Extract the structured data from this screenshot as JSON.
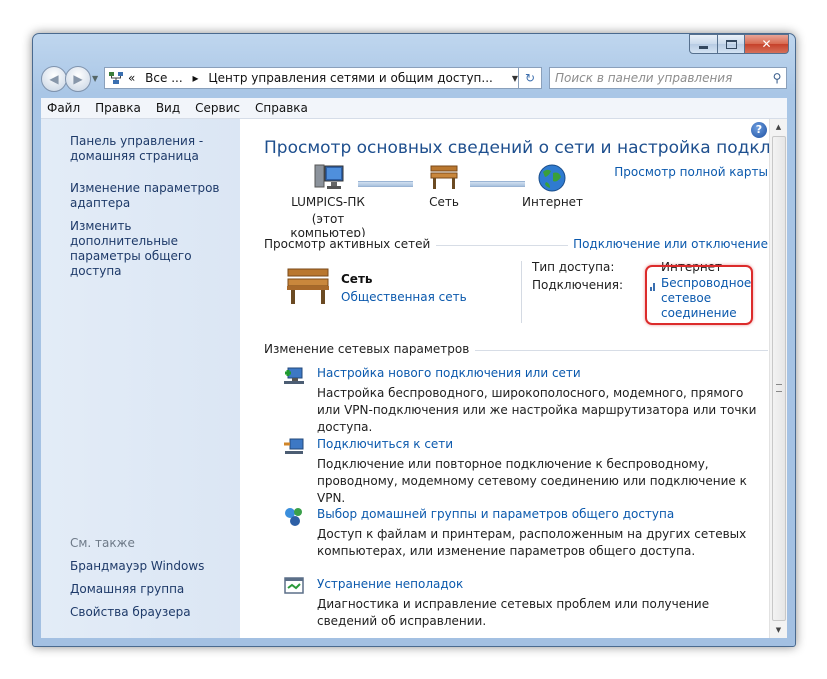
{
  "window": {
    "minimize_label": "minimize",
    "maximize_label": "maximize",
    "close_glyph": "✕"
  },
  "nav": {
    "back_icon": "◀",
    "forward_icon": "▶",
    "address_icon": "network-center-icon",
    "crumbs": [
      "Все ...",
      "Центр управления сетями и общим доступ..."
    ],
    "crumb_prefix": "«",
    "crumb_separator": "▸",
    "refresh_icon": "↻",
    "search_placeholder": "Поиск в панели управления"
  },
  "menu": [
    "Файл",
    "Правка",
    "Вид",
    "Сервис",
    "Справка"
  ],
  "sidebar": {
    "links": [
      "Панель управления - домашняя страница",
      "Изменение параметров адаптера",
      "Изменить дополнительные параметры общего доступа"
    ],
    "see_also_title": "См. также",
    "see_also": [
      "Брандмауэр Windows",
      "Домашняя группа",
      "Свойства браузера"
    ]
  },
  "main": {
    "title": "Просмотр основных сведений о сети и настройка подключений",
    "full_map_link": "Просмотр полной карты",
    "map": {
      "computer": "LUMPICS-ПК",
      "computer_note": "(этот компьютер)",
      "network": "Сеть",
      "internet": "Интернет"
    },
    "active_networks": {
      "title": "Просмотр активных сетей",
      "connect_link": "Подключение или отключение",
      "network_name": "Сеть",
      "network_type": "Общественная сеть",
      "access_type_label": "Тип доступа:",
      "access_type_value": "Интернет",
      "connections_label": "Подключения:",
      "connection_link": "Беспроводное сетевое соединение"
    },
    "change_settings": {
      "title": "Изменение сетевых параметров",
      "tasks": [
        {
          "icon": "new-connection-icon",
          "link": "Настройка нового подключения или сети",
          "desc": "Настройка беспроводного, широкополосного, модемного, прямого или VPN-подключения или же настройка маршрутизатора или точки доступа."
        },
        {
          "icon": "connect-network-icon",
          "link": "Подключиться к сети",
          "desc": "Подключение или повторное подключение к беспроводному, проводному, модемному сетевому соединению или подключение к VPN."
        },
        {
          "icon": "homegroup-icon",
          "link": "Выбор домашней группы и параметров общего доступа",
          "desc": "Доступ к файлам и принтерам, расположенным на других сетевых компьютерах, или изменение параметров общего доступа."
        },
        {
          "icon": "troubleshoot-icon",
          "link": "Устранение неполадок",
          "desc": "Диагностика и исправление сетевых проблем или получение сведений об исправлении."
        }
      ]
    }
  },
  "colors": {
    "link": "#0b59ad",
    "title": "#1e4f8e",
    "highlight": "#dc2b2b"
  }
}
